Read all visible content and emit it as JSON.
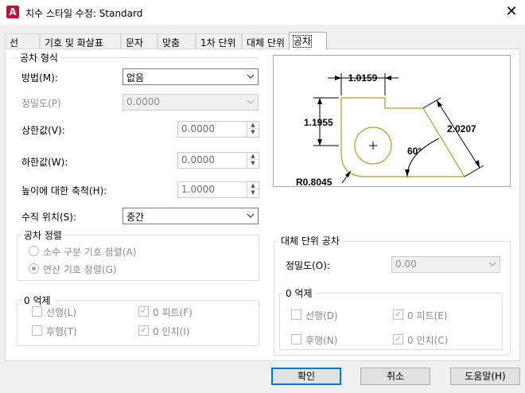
{
  "window": {
    "title": "치수 스타일 수정: Standard",
    "app_icon_letter": "A",
    "close_glyph": "✕"
  },
  "tabs": [
    {
      "label": "선"
    },
    {
      "label": "기호 및 화살표"
    },
    {
      "label": "문자"
    },
    {
      "label": "맞춤"
    },
    {
      "label": "1차 단위"
    },
    {
      "label": "대체 단위"
    },
    {
      "label": "공차",
      "active": true
    }
  ],
  "tolerance_format": {
    "group_title": "공차 형식",
    "method_label": "방법(M):",
    "method_value": "없음",
    "precision_label": "정밀도(P)",
    "precision_value": "0.0000",
    "upper_label": "상한값(V):",
    "upper_value": "0.0000",
    "lower_label": "하한값(W):",
    "lower_value": "0.0000",
    "scale_label": "높이에 대한 축척(H):",
    "scale_value": "1.0000",
    "vpos_label": "수직 위치(S):",
    "vpos_value": "중간"
  },
  "tolerance_alignment": {
    "group_title": "공차 정렬",
    "opt1": "소수 구분 기호 정렬(A)",
    "opt2": "연산 기호 정렬(G)"
  },
  "zero_suppression": {
    "group_title": "0 억제",
    "leading": "선행(L)",
    "trailing": "후행(T)",
    "feet": "0 피트(F)",
    "inches": "0 인치(I)"
  },
  "alt_unit_tolerance": {
    "group_title": "대체 단위 공차",
    "precision_label": "정밀도(O):",
    "precision_value": "0.00"
  },
  "alt_zero_suppression": {
    "group_title": "0 억제",
    "leading": "선행(D)",
    "trailing": "후행(N)",
    "feet": "0 피트(E)",
    "inches": "0 인치(C)"
  },
  "preview": {
    "dim_top": "1.0159",
    "dim_left": "1.1955",
    "dim_right": "2.0207",
    "angle": "60°",
    "radius": "R0.8045",
    "shape_color": "#b89a20"
  },
  "buttons": {
    "ok": "확인",
    "cancel": "취소",
    "help": "도움말(H)"
  },
  "colors": {
    "accent": "#0078d7",
    "app_icon": "#c8102e"
  }
}
